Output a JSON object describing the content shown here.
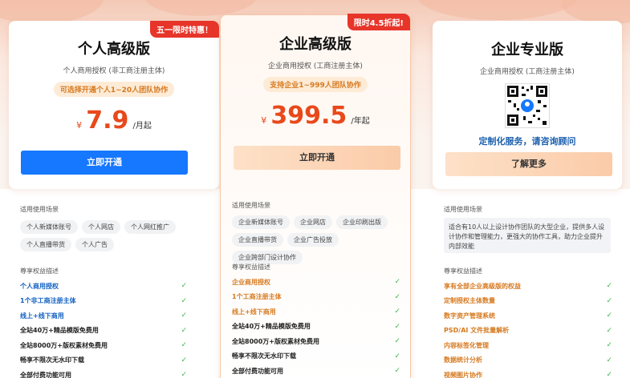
{
  "plans": [
    {
      "ribbon": "五一限时特惠！",
      "title": "个人高级版",
      "subtitle": "个人商用授权 (非工商注册主体)",
      "pill": "可选择开通个人1~20人团队协作",
      "currency": "¥",
      "price": "7.9",
      "unit": "/月起",
      "button": "立即开通",
      "scenes_label": "适用使用场景",
      "scenes": [
        "个人新媒体账号",
        "个人网店",
        "个人网红推广",
        "个人直播带货",
        "个人广告"
      ],
      "features_label": "尊享权益描述",
      "features": [
        "个人商用授权",
        "1个非工商注册主体",
        "线上+线下商用",
        "全站40万+精品模版免费用",
        "全站8000万+版权素材免费用",
        "畅享不限次无水印下载",
        "全部付费功能可用"
      ]
    },
    {
      "ribbon": "限时4.5折起!",
      "title": "企业高级版",
      "subtitle": "企业商用授权 (工商注册主体)",
      "pill": "支持企业1~999人团队协作",
      "currency": "¥",
      "price": "399.5",
      "unit": "/年起",
      "button": "立即开通",
      "scenes_label": "适用使用场景",
      "scenes": [
        "企业新媒体账号",
        "企业网店",
        "企业印刷出版",
        "企业直播带货",
        "企业广告投放",
        "企业跨部门设计协作"
      ],
      "features_label": "尊享权益描述",
      "features": [
        "企业商用授权",
        "1个工商注册主体",
        "线上+线下商用",
        "全站40万+精品模版免费用",
        "全站8000万+版权素材免费用",
        "畅享不限次无水印下载",
        "全部付费功能可用"
      ]
    },
    {
      "title": "企业专业版",
      "subtitle": "企业商用授权 (工商注册主体)",
      "consult": "定制化服务，请咨询顾问",
      "button": "了解更多",
      "scenes_label": "适用使用场景",
      "scenes_desc": "适合有10人以上设计协作团队的大型企业，提供多人设计协作和管理能力，更强大的协作工具，助力企业提升内部效能",
      "features_label": "尊享权益描述",
      "features": [
        "享有全部企业高级版的权益",
        "定制授权主体数量",
        "数字资产管理系统",
        "PSD/AI 文件批量解析",
        "内容标签化管理",
        "数据统计分析",
        "视频图片协作"
      ]
    }
  ],
  "colors": {
    "blue_btn": "#1677ff",
    "price_orange": "#e8491b",
    "check_green": "#3bb54a",
    "ribbon_red": "#e7352a"
  }
}
